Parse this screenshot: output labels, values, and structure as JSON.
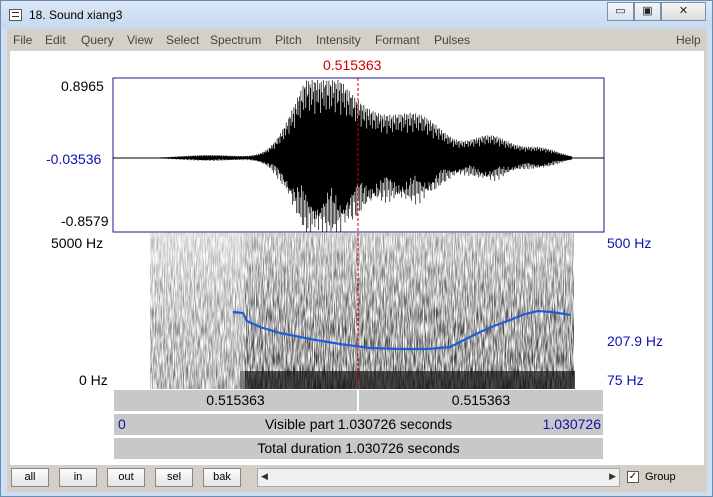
{
  "window": {
    "title": "18. Sound xiang3",
    "buttons": [
      "▭",
      "▣",
      "✕"
    ]
  },
  "menu": [
    "File",
    "Edit",
    "Query",
    "View",
    "Select",
    "Spectrum",
    "Pitch",
    "Intensity",
    "Formant",
    "Pulses"
  ],
  "help": "Help",
  "cursor_time": "0.515363",
  "waveform": {
    "top": "0.8965",
    "mid": "-0.03536",
    "bottom": "-0.8579"
  },
  "spectrogram": {
    "freq_top": "5000 Hz",
    "freq_bottom": "0 Hz"
  },
  "pitch": {
    "top": "500 Hz",
    "mid": "207.9 Hz",
    "bottom": "75 Hz"
  },
  "bars": {
    "left_segment": "0.515363",
    "right_segment": "0.515363",
    "visible_start": "0",
    "visible_label": "Visible part 1.030726 seconds",
    "visible_end": "1.030726",
    "total_label": "Total duration 1.030726 seconds"
  },
  "buttons": [
    "all",
    "in",
    "out",
    "sel",
    "bak"
  ],
  "group": {
    "label": "Group",
    "checked": true,
    "mark": "✓"
  },
  "colors": {
    "cursor": "#d00000",
    "pitch": "#1f5fd6",
    "axis_blue": "#1010b0"
  }
}
